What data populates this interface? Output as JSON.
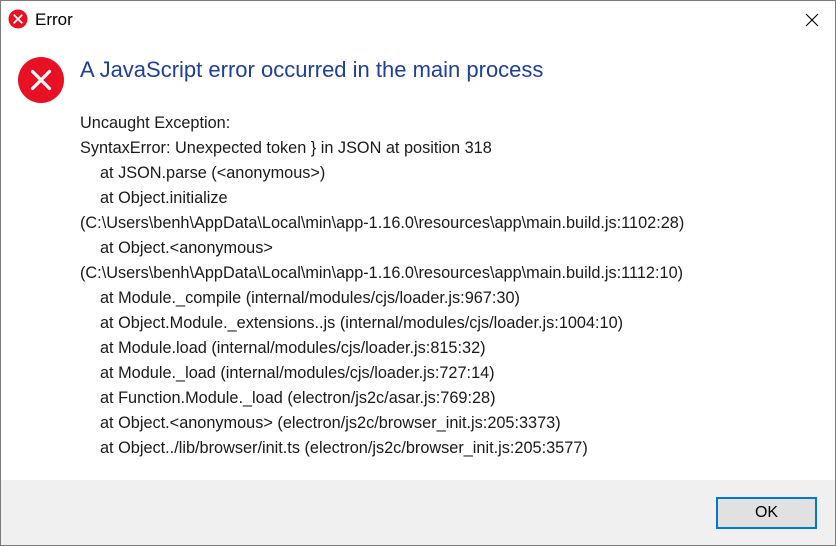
{
  "window": {
    "title": "Error",
    "icon": "error-icon",
    "close_icon": "close-icon"
  },
  "message": {
    "icon": "error-icon",
    "heading": "A JavaScript error occurred in the main process",
    "lines": [
      {
        "text": "Uncaught Exception:",
        "indent": false
      },
      {
        "text": "SyntaxError: Unexpected token } in JSON at position 318",
        "indent": false
      },
      {
        "text": "at JSON.parse (<anonymous>)",
        "indent": true
      },
      {
        "text": "at Object.initialize",
        "indent": true
      },
      {
        "text": "(C:\\Users\\benh\\AppData\\Local\\min\\app-1.16.0\\resources\\app\\main.build.js:1102:28)",
        "indent": false
      },
      {
        "text": "at Object.<anonymous>",
        "indent": true
      },
      {
        "text": "(C:\\Users\\benh\\AppData\\Local\\min\\app-1.16.0\\resources\\app\\main.build.js:1112:10)",
        "indent": false
      },
      {
        "text": "at Module._compile (internal/modules/cjs/loader.js:967:30)",
        "indent": true
      },
      {
        "text": "at Object.Module._extensions..js (internal/modules/cjs/loader.js:1004:10)",
        "indent": true
      },
      {
        "text": "at Module.load (internal/modules/cjs/loader.js:815:32)",
        "indent": true
      },
      {
        "text": "at Module._load (internal/modules/cjs/loader.js:727:14)",
        "indent": true
      },
      {
        "text": "at Function.Module._load (electron/js2c/asar.js:769:28)",
        "indent": true
      },
      {
        "text": "at Object.<anonymous> (electron/js2c/browser_init.js:205:3373)",
        "indent": true
      },
      {
        "text": "at Object../lib/browser/init.ts (electron/js2c/browser_init.js:205:3577)",
        "indent": true
      }
    ]
  },
  "footer": {
    "ok_label": "OK"
  },
  "colors": {
    "error_red": "#e81123",
    "heading_blue": "#1f3f9a",
    "footer_bg": "#f0f0f0",
    "button_focus_border": "#0078d7"
  }
}
